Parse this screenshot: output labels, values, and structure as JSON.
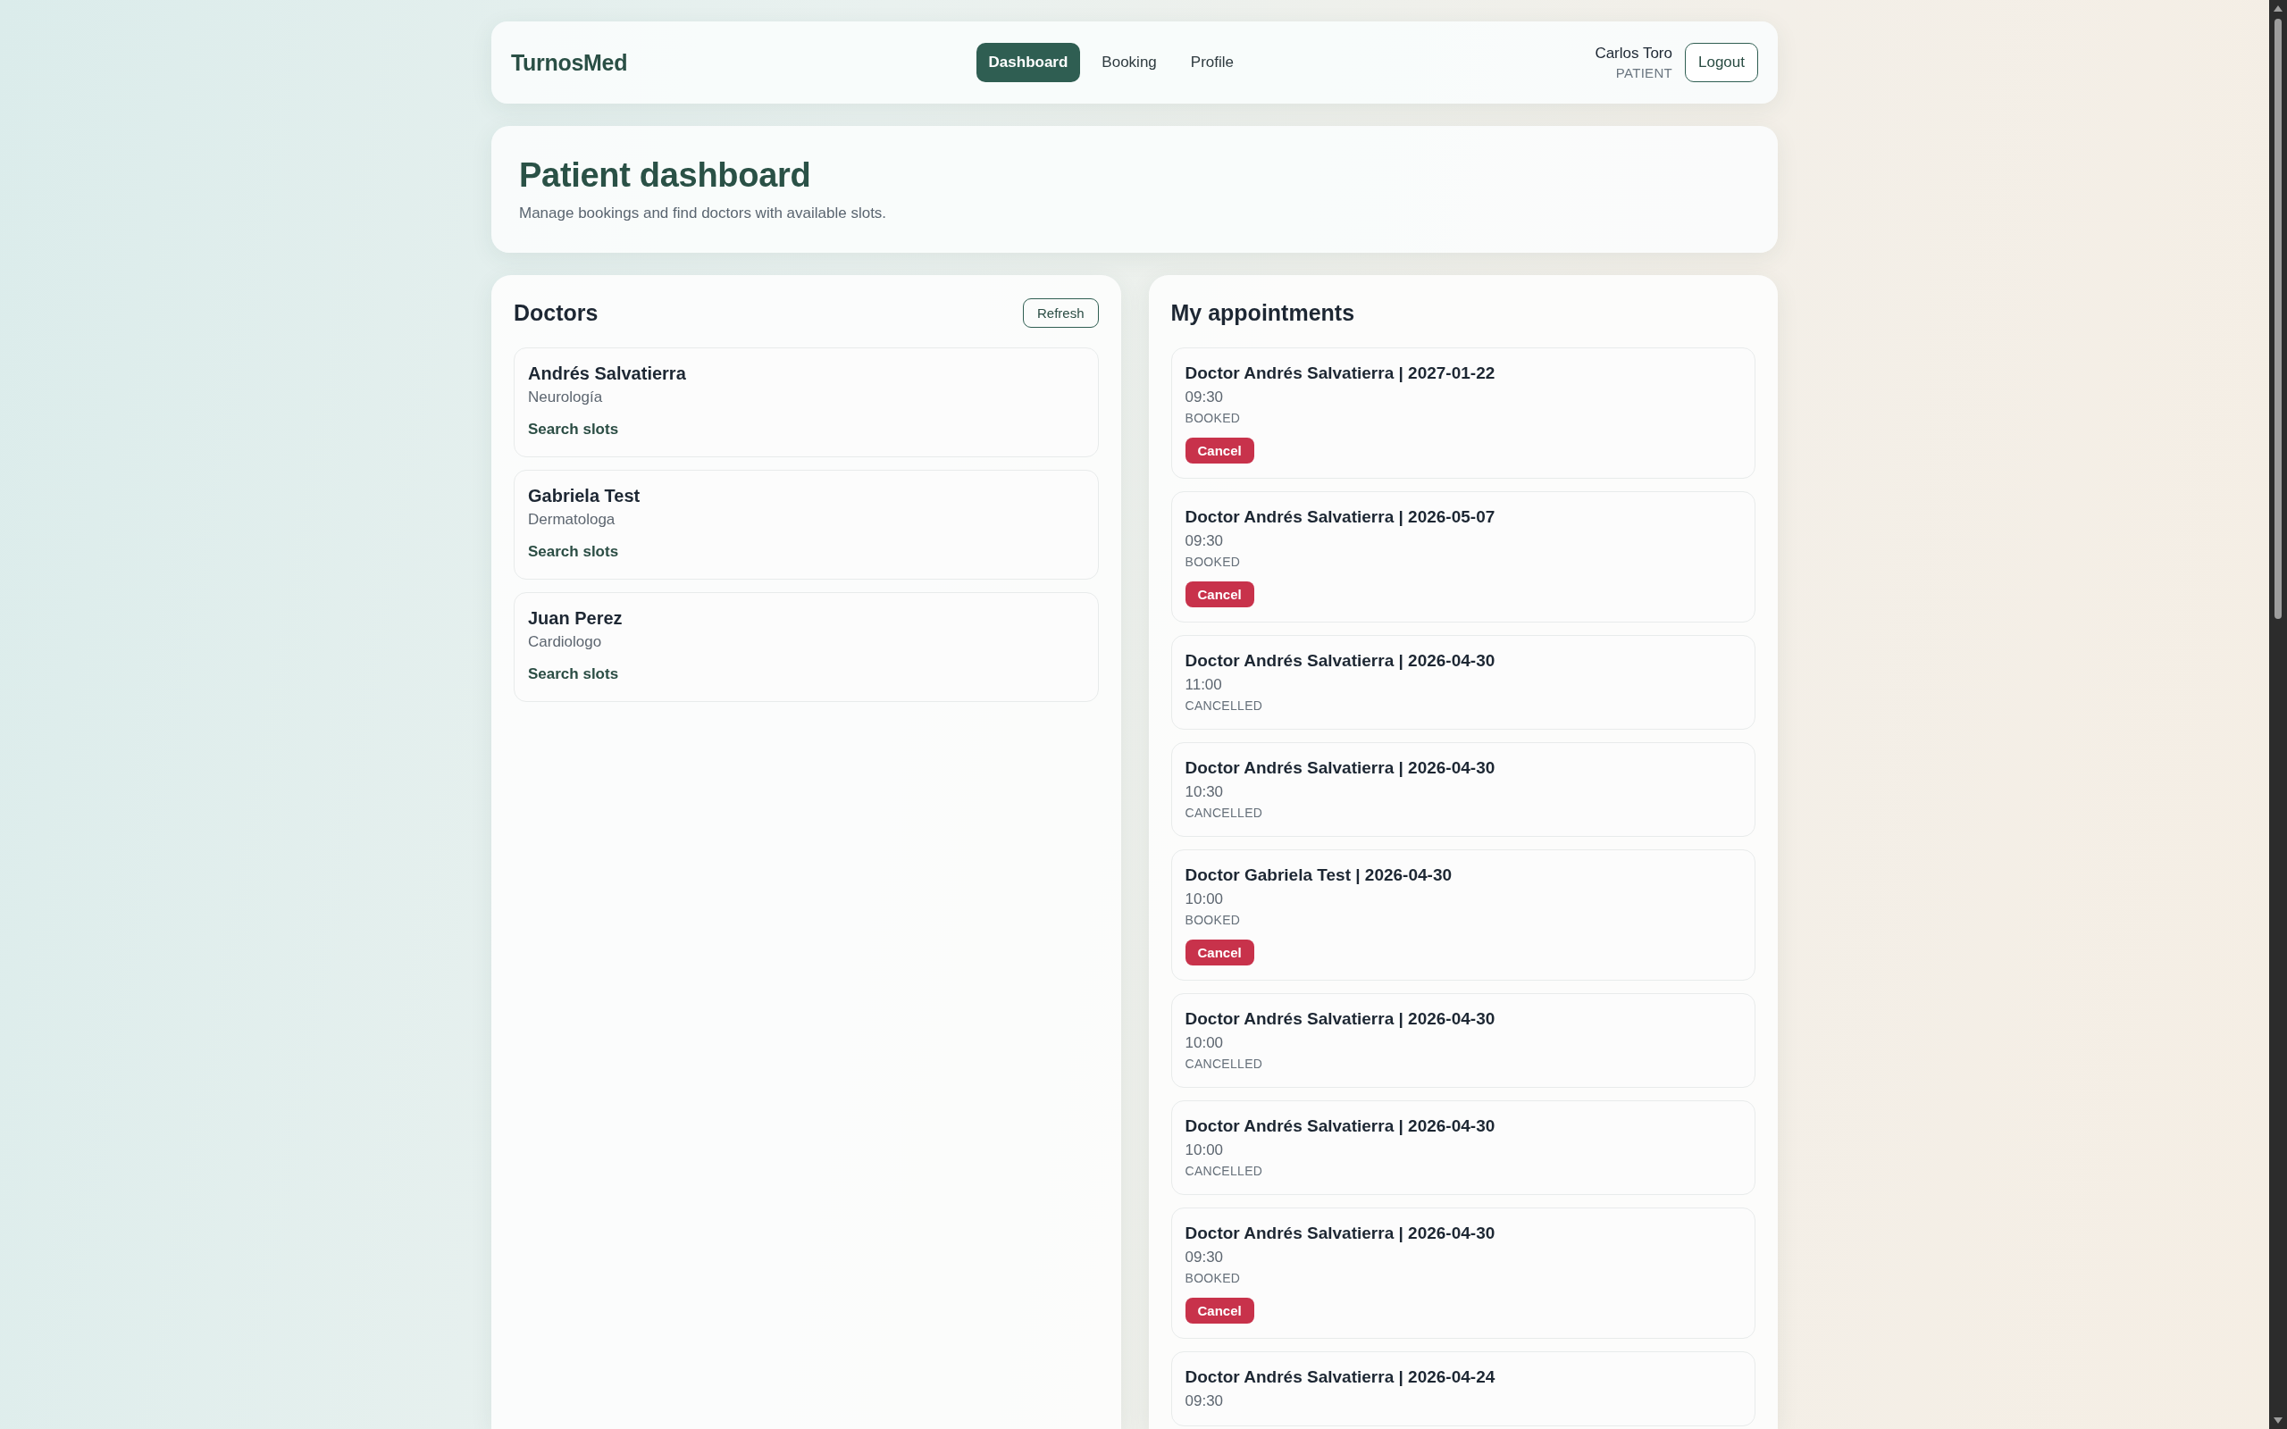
{
  "header": {
    "brand": "TurnosMed",
    "nav": [
      {
        "label": "Dashboard",
        "selected": true
      },
      {
        "label": "Booking",
        "selected": false
      },
      {
        "label": "Profile",
        "selected": false
      }
    ],
    "user": {
      "name": "Carlos Toro",
      "role": "PATIENT"
    },
    "logout_button": "Logout"
  },
  "page_header": {
    "title": "Patient dashboard",
    "subtitle": "Manage bookings and find doctors with available slots."
  },
  "doctors": {
    "title": "Doctors",
    "refresh_button": "Refresh",
    "items": [
      {
        "name": "Andrés Salvatierra",
        "specialty": "Neurología",
        "action": "Search slots"
      },
      {
        "name": "Gabriela Test",
        "specialty": "Dermatologa",
        "action": "Search slots"
      },
      {
        "name": "Juan Perez",
        "specialty": "Cardiologo",
        "action": "Search slots"
      }
    ]
  },
  "appointments": {
    "title": "My appointments",
    "items": [
      {
        "title": "Doctor Andrés Salvatierra | 2027-01-22",
        "time": "09:30",
        "status": "BOOKED",
        "cancel_button": "Cancel"
      },
      {
        "title": "Doctor Andrés Salvatierra | 2026-05-07",
        "time": "09:30",
        "status": "BOOKED",
        "cancel_button": "Cancel"
      },
      {
        "title": "Doctor Andrés Salvatierra | 2026-04-30",
        "time": "11:00",
        "status": "CANCELLED"
      },
      {
        "title": "Doctor Andrés Salvatierra | 2026-04-30",
        "time": "10:30",
        "status": "CANCELLED"
      },
      {
        "title": "Doctor Gabriela Test | 2026-04-30",
        "time": "10:00",
        "status": "BOOKED",
        "cancel_button": "Cancel"
      },
      {
        "title": "Doctor Andrés Salvatierra | 2026-04-30",
        "time": "10:00",
        "status": "CANCELLED"
      },
      {
        "title": "Doctor Andrés Salvatierra | 2026-04-30",
        "time": "10:00",
        "status": "CANCELLED"
      },
      {
        "title": "Doctor Andrés Salvatierra | 2026-04-30",
        "time": "09:30",
        "status": "BOOKED",
        "cancel_button": "Cancel"
      },
      {
        "title": "Doctor Andrés Salvatierra | 2026-04-24",
        "time": "09:30"
      }
    ]
  }
}
